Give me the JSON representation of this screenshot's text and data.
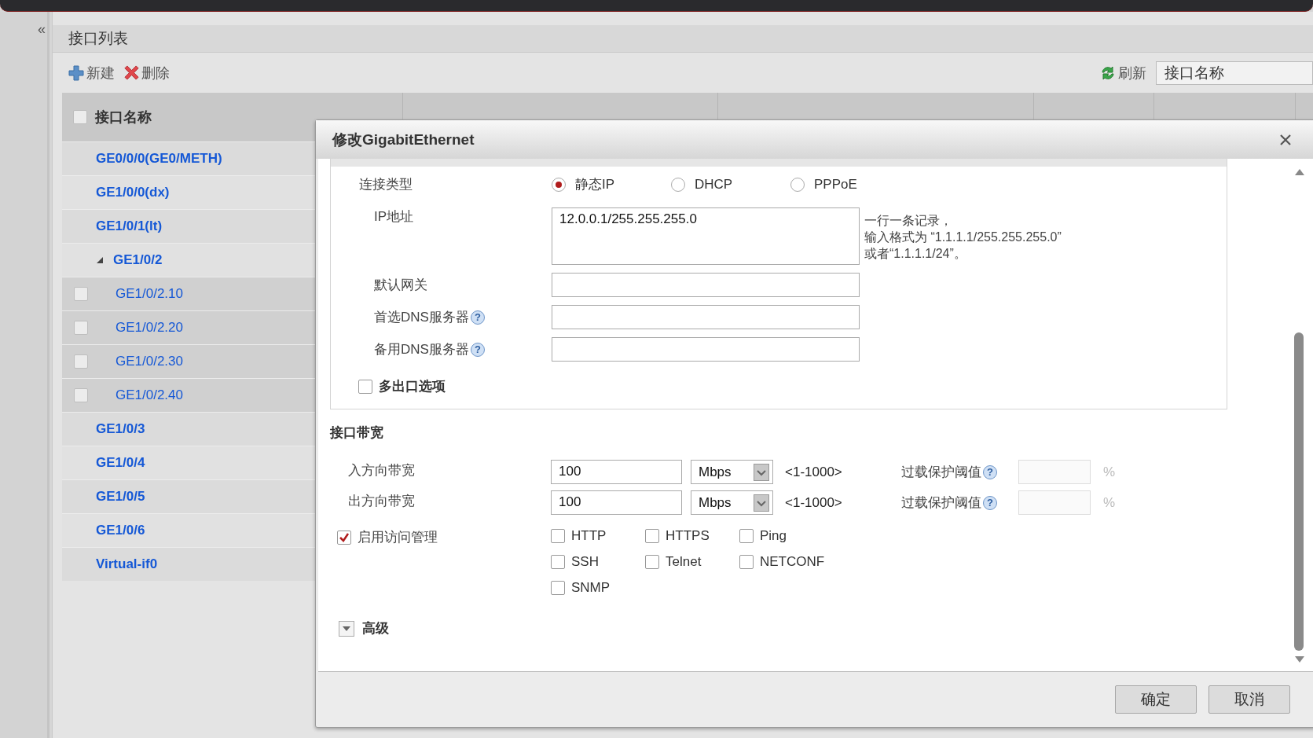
{
  "sidebar_toggle": "«",
  "panel": {
    "title": "接口列表",
    "toolbar": [
      {
        "kind": "add",
        "label": "新建"
      },
      {
        "kind": "delete",
        "label": "删除"
      }
    ],
    "refresh": {
      "label": "刷新"
    },
    "search": {
      "placeholder": "接口名称"
    }
  },
  "table": {
    "select_all": {
      "checked": false
    },
    "columns": [
      "接口名称"
    ],
    "rows": [
      {
        "name": "GE0/0/0(GE0/METH)"
      },
      {
        "name": "GE1/0/0(dx)"
      },
      {
        "name": "GE1/0/1(lt)"
      },
      {
        "name": "GE1/0/2",
        "expanded": true,
        "children": [
          {
            "name": "GE1/0/2.10",
            "checked": false
          },
          {
            "name": "GE1/0/2.20",
            "checked": false
          },
          {
            "name": "GE1/0/2.30",
            "checked": false
          },
          {
            "name": "GE1/0/2.40",
            "checked": false
          }
        ]
      },
      {
        "name": "GE1/0/3"
      },
      {
        "name": "GE1/0/4"
      },
      {
        "name": "GE1/0/5"
      },
      {
        "name": "GE1/0/6"
      },
      {
        "name": "Virtual-if0"
      }
    ]
  },
  "dialog": {
    "title": "修改GigabitEthernet",
    "connection_type": {
      "label": "连接类型",
      "options": [
        {
          "label": "静态IP",
          "selected": true
        },
        {
          "label": "DHCP",
          "selected": false
        },
        {
          "label": "PPPoE",
          "selected": false
        }
      ]
    },
    "fields": [
      {
        "kind": "textarea",
        "label": "IP地址",
        "value": "12.0.0.1/255.255.255.0",
        "hint": [
          "一行一条记录，",
          "输入格式为 “1.1.1.1/255.255.255.0”",
          "或者“1.1.1.1/24”。"
        ]
      },
      {
        "kind": "input",
        "label": "默认网关"
      },
      {
        "kind": "input",
        "label": "首选DNS服务器",
        "help": "?"
      },
      {
        "kind": "input",
        "label": "备用DNS服务器",
        "help": "?"
      }
    ],
    "multi_exit": {
      "label": "多出口选项",
      "checked": false
    },
    "bandwidth": {
      "title": "接口带宽",
      "rows": [
        {
          "label": "入方向带宽",
          "value": "100",
          "unit": "Mbps",
          "range": "<1-1000>",
          "threshold_label": "过载保护阈值",
          "help": "?",
          "threshold_disabled": true,
          "threshold_unit": "%"
        },
        {
          "label": "出方向带宽",
          "value": "100",
          "unit": "Mbps",
          "range": "<1-1000>",
          "threshold_label": "过载保护阈值",
          "help": "?",
          "threshold_disabled": true,
          "threshold_unit": "%"
        }
      ]
    },
    "access": {
      "label": "启用访问管理",
      "checked": true,
      "services": [
        {
          "label": "HTTP",
          "checked": false
        },
        {
          "label": "HTTPS",
          "checked": false
        },
        {
          "label": "Ping",
          "checked": false
        },
        {
          "label": "SSH",
          "checked": false
        },
        {
          "label": "Telnet",
          "checked": false
        },
        {
          "label": "NETCONF",
          "checked": false
        },
        {
          "label": "SNMP",
          "checked": false
        }
      ]
    },
    "advanced": {
      "label": "高级",
      "expanded": false
    },
    "buttons": [
      {
        "label": "确定"
      },
      {
        "label": "取消"
      }
    ]
  }
}
